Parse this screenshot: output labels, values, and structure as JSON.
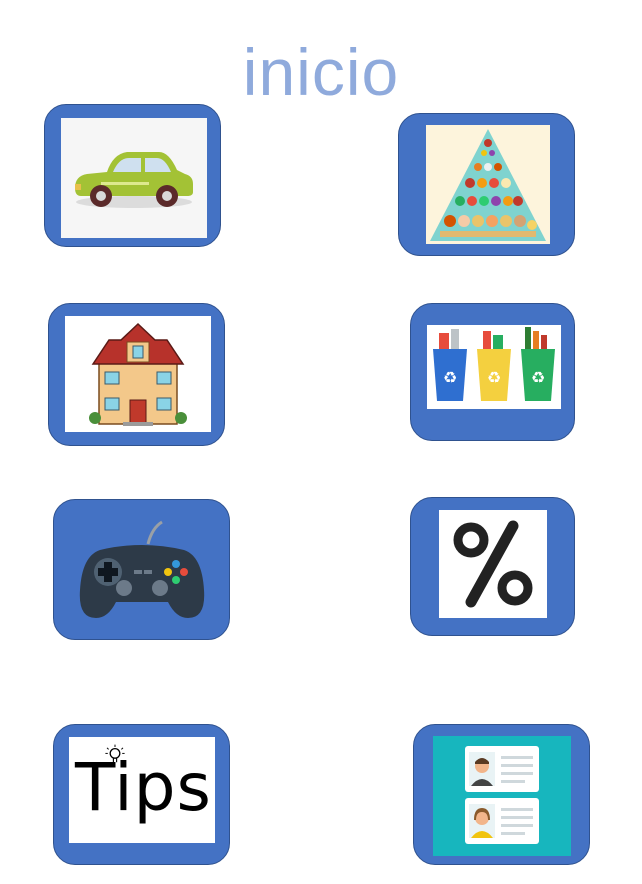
{
  "page": {
    "title": "inicio"
  },
  "tiles": {
    "car": {
      "icon": "car-icon"
    },
    "food": {
      "icon": "food-pyramid-icon"
    },
    "house": {
      "icon": "house-icon"
    },
    "recycling": {
      "icon": "recycling-bins-icon"
    },
    "games": {
      "icon": "gamepad-icon"
    },
    "percent": {
      "icon": "percent-icon",
      "symbol": "%"
    },
    "tips": {
      "icon": "lightbulb-icon",
      "label": "Tips"
    },
    "profiles": {
      "icon": "profile-cards-icon"
    }
  },
  "colors": {
    "tile": "#4472c4",
    "tile_border": "#2f528f",
    "title": "#8faadc",
    "profiles_bg": "#17b6be"
  }
}
